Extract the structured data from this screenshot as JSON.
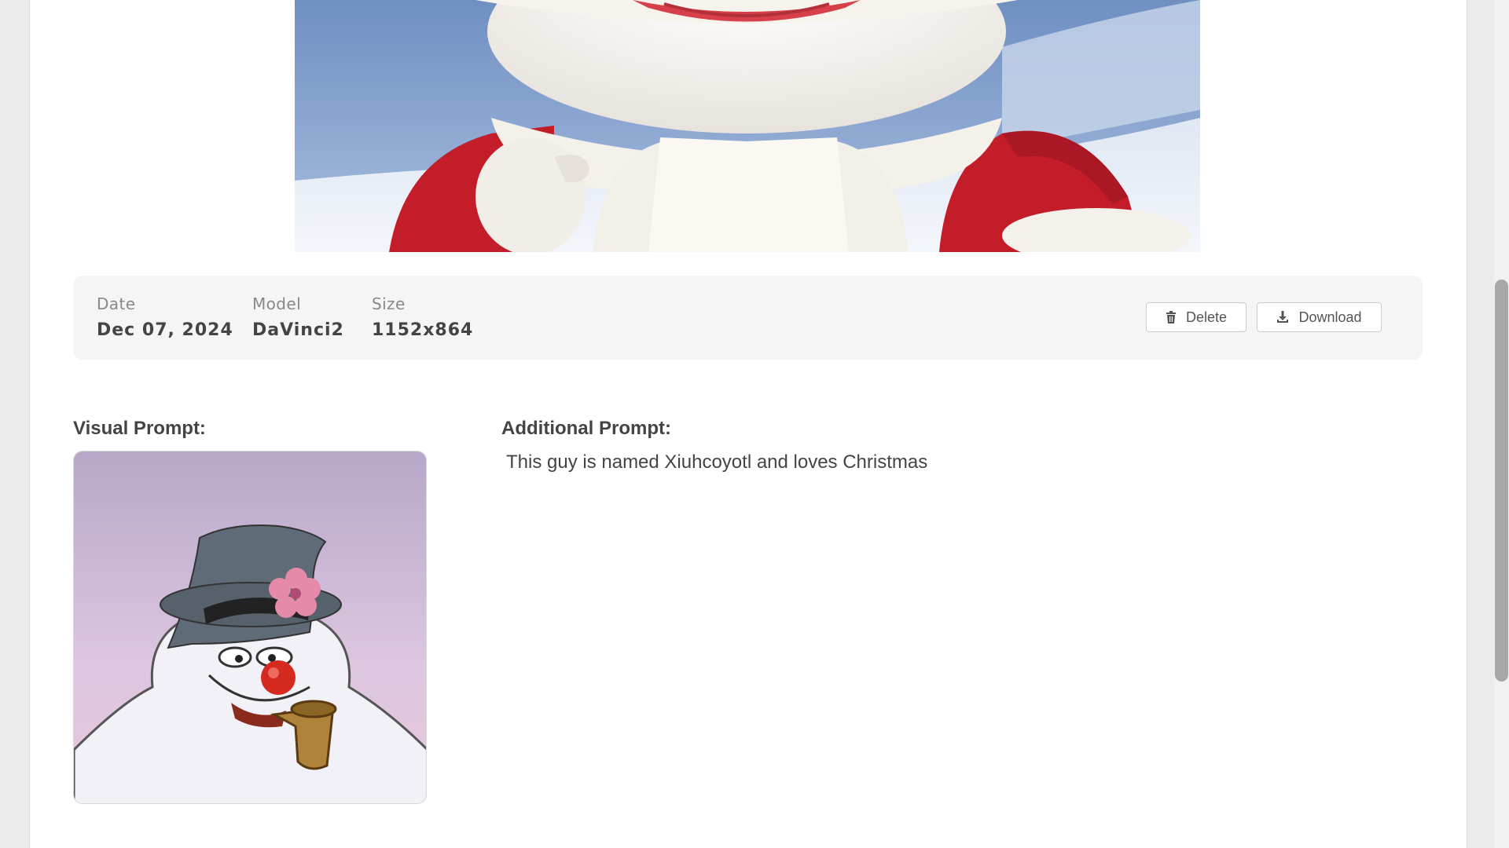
{
  "generated_image": {
    "alt": "Generated image of a white furry mascot in a red Santa suit in a snowy landscape"
  },
  "meta": {
    "date_label": "Date",
    "date_value": "Dec 07, 2024",
    "model_label": "Model",
    "model_value": "DaVinci2",
    "size_label": "Size",
    "size_value": "1152x864"
  },
  "actions": {
    "delete_label": "Delete",
    "delete_icon": "trash-icon",
    "download_label": "Download",
    "download_icon": "download-icon"
  },
  "visual_prompt": {
    "title": "Visual Prompt:",
    "image_alt": "Cartoon snowman with a top hat, pink flower, red nose and corncob pipe"
  },
  "additional_prompt": {
    "title": "Additional Prompt:",
    "text": "This guy is named Xiuhcoyotl and loves Christmas"
  },
  "colors": {
    "page_background": "#ebebeb",
    "card_background": "#ffffff",
    "meta_bar_background": "#f5f5f5",
    "accent_red": "#c8202c"
  }
}
